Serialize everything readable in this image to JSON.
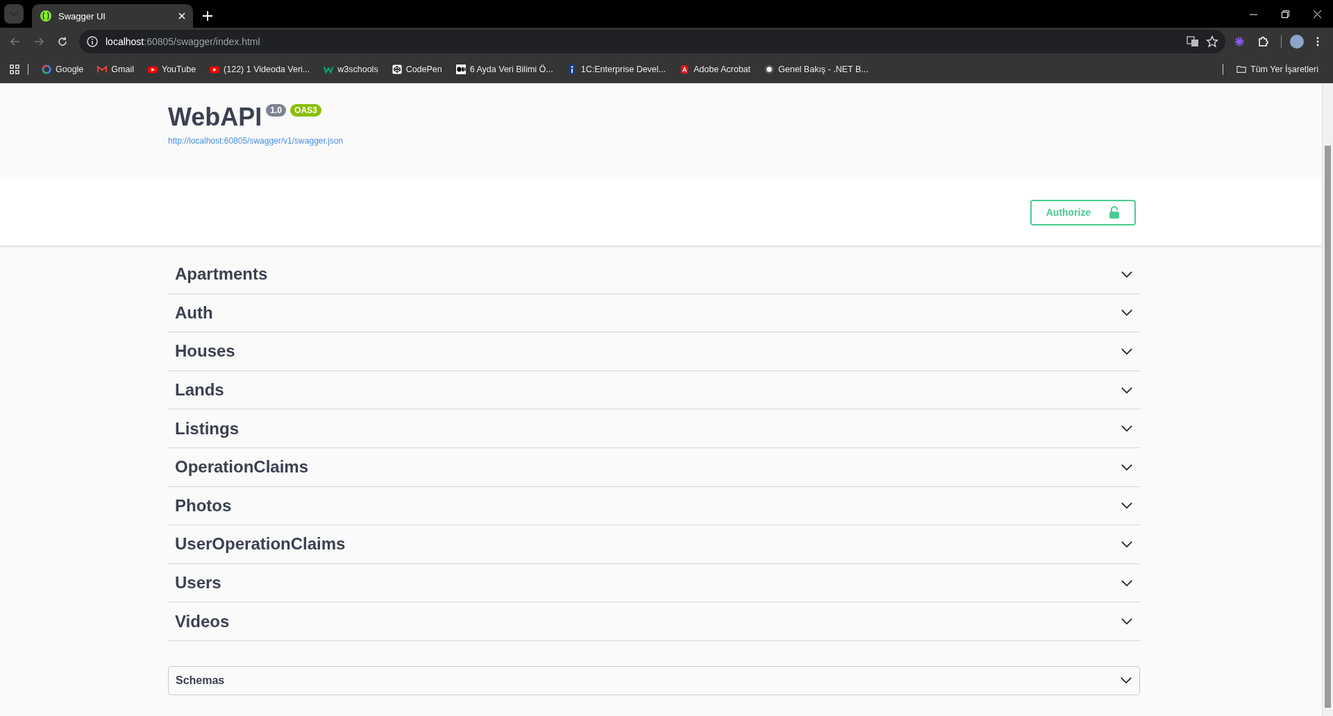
{
  "browser": {
    "tab": {
      "title": "Swagger UI",
      "selected": true
    },
    "address": {
      "host": "localhost",
      "path": ":60805/swagger/index.html"
    },
    "bookmarks": [
      {
        "label": "Google",
        "kind": "ring"
      },
      {
        "label": "Gmail",
        "kind": "envelope"
      },
      {
        "label": "YouTube",
        "kind": "play"
      },
      {
        "label": "(122) 1 Videoda Veri...",
        "kind": "play"
      },
      {
        "label": "w3schools",
        "kind": "zigzag"
      },
      {
        "label": "CodePen",
        "kind": "cube"
      },
      {
        "label": "6 Ayda Veri Bilimi Ö...",
        "kind": "ovals"
      },
      {
        "label": "1C:Enterprise Devel...",
        "kind": "info"
      },
      {
        "label": "Adobe Acrobat",
        "kind": "document"
      },
      {
        "label": "Genel Bakış - .NET B...",
        "kind": "badge"
      }
    ],
    "all_bookmarks": "Tüm Yer İşaretleri"
  },
  "header": {
    "title": "WebAPI",
    "version": "1.0",
    "spec": "OAS3",
    "url": "http://localhost:60805/swagger/v1/swagger.json"
  },
  "authorize": {
    "label": "Authorize"
  },
  "tags": [
    {
      "name": "Apartments",
      "expanded": false
    },
    {
      "name": "Auth",
      "expanded": false
    },
    {
      "name": "Houses",
      "expanded": false
    },
    {
      "name": "Lands",
      "expanded": false
    },
    {
      "name": "Listings",
      "expanded": false
    },
    {
      "name": "OperationClaims",
      "expanded": false
    },
    {
      "name": "Photos",
      "expanded": false
    },
    {
      "name": "UserOperationClaims",
      "expanded": false
    },
    {
      "name": "Users",
      "expanded": false
    },
    {
      "name": "Videos",
      "expanded": false
    }
  ],
  "schemas": {
    "title": "Schemas",
    "expanded": false
  }
}
